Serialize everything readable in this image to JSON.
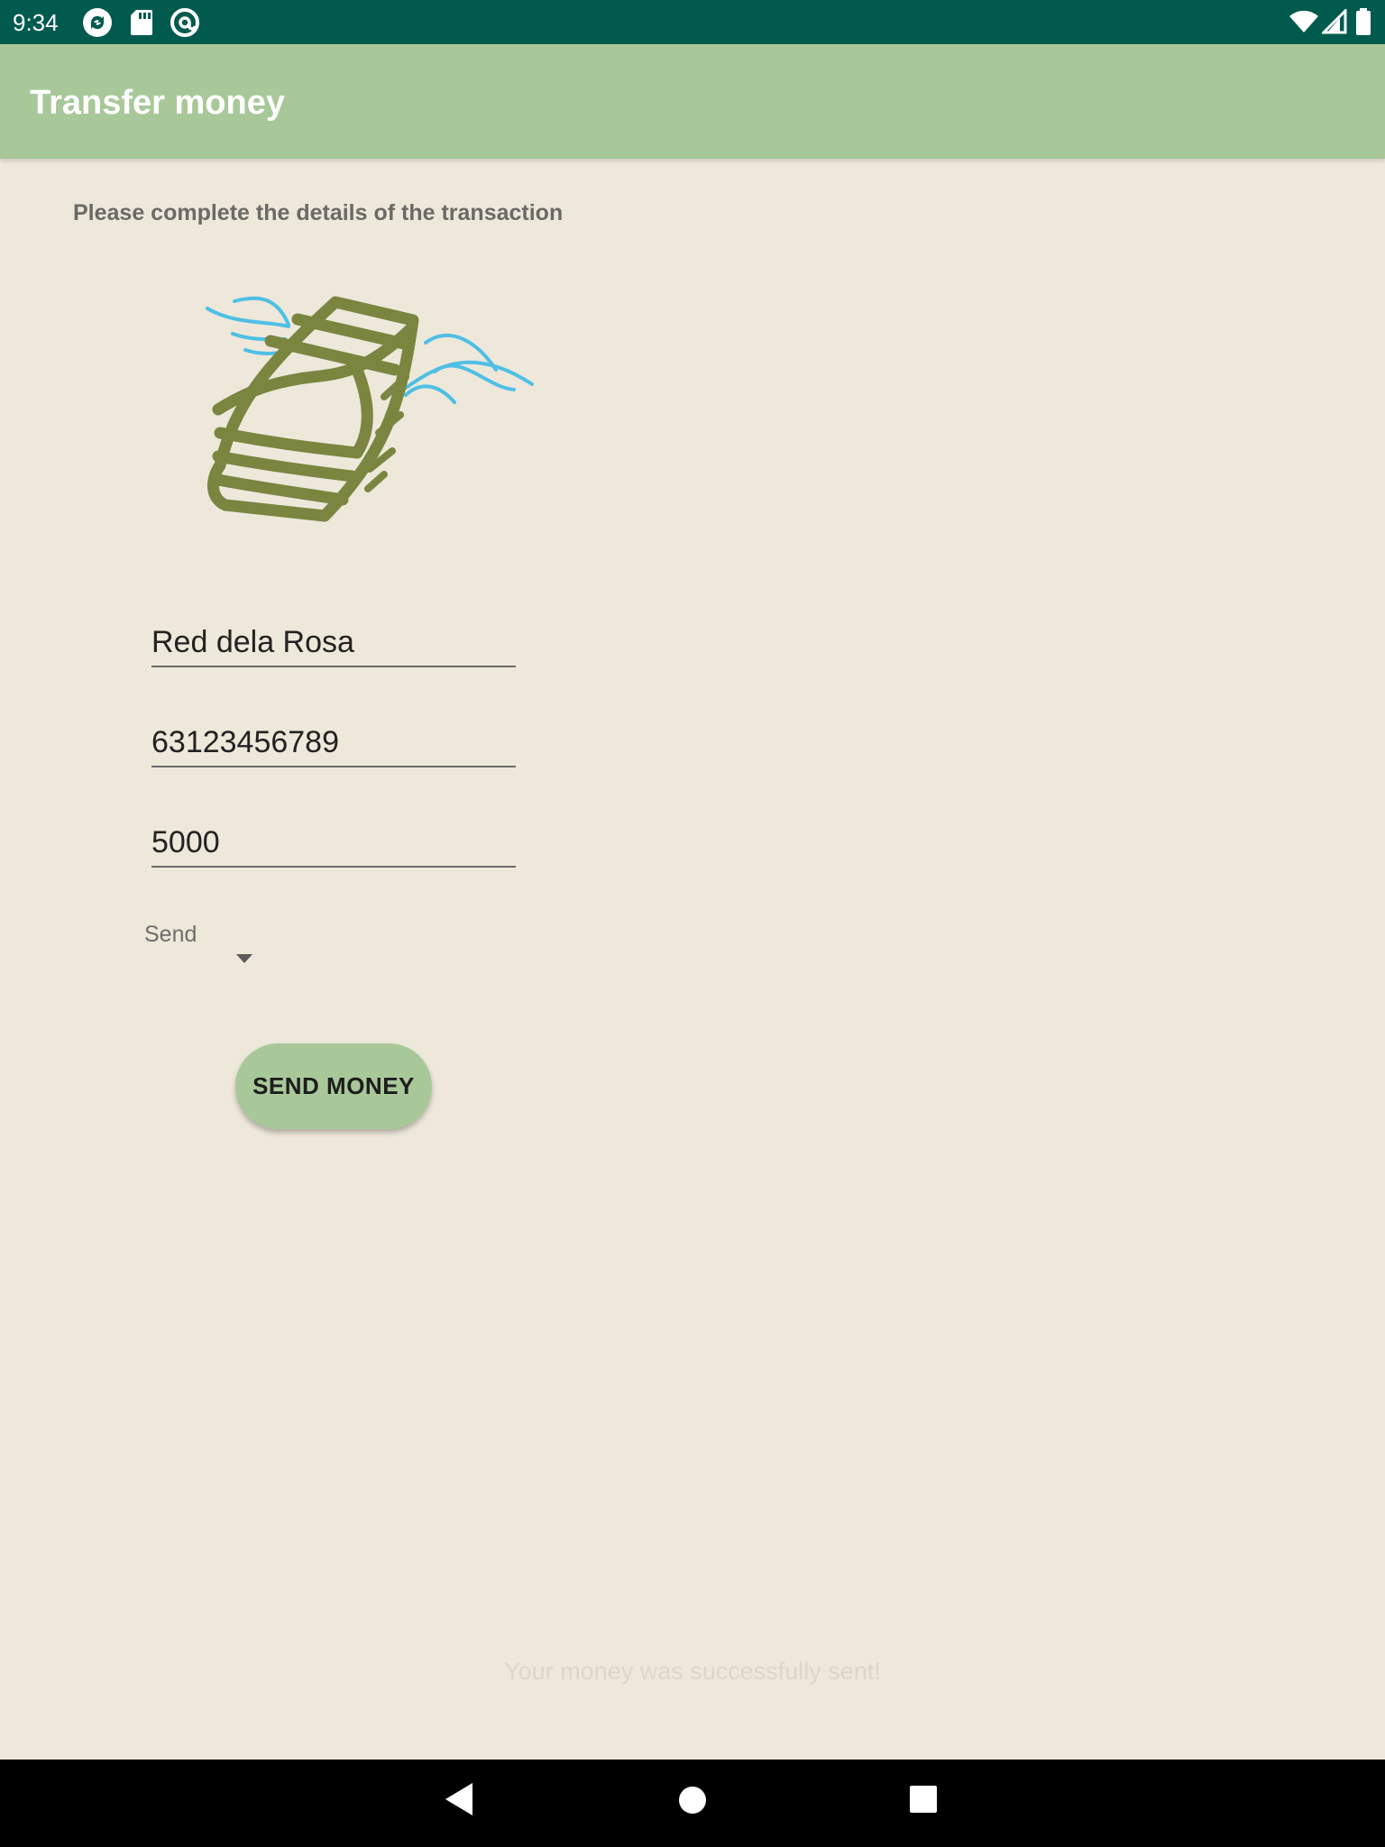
{
  "status_bar": {
    "time": "9:34",
    "left_icons": [
      "sync-icon",
      "sd-card-icon",
      "at-sign-icon"
    ],
    "right_icons": [
      "wifi-icon",
      "signal-icon",
      "battery-icon"
    ]
  },
  "app_bar": {
    "title": "Transfer money"
  },
  "form": {
    "instructions": "Please complete the details of the transaction",
    "illustration": "flying-money-icon",
    "recipient_name": "Red dela Rosa",
    "account_number": "63123456789",
    "amount": "5000",
    "spinner_selected": "Send",
    "submit_label": "SEND MONEY"
  },
  "success_message": "Your money was successfully sent!",
  "navigation_bar": {
    "buttons": [
      "back-icon",
      "home-icon",
      "recents-icon"
    ]
  },
  "colors": {
    "status_bar": "#005a4e",
    "app_bar": "#a8c899",
    "background": "#ede8da",
    "money_green": "#7a8540",
    "wing_blue": "#4fbfe6"
  }
}
